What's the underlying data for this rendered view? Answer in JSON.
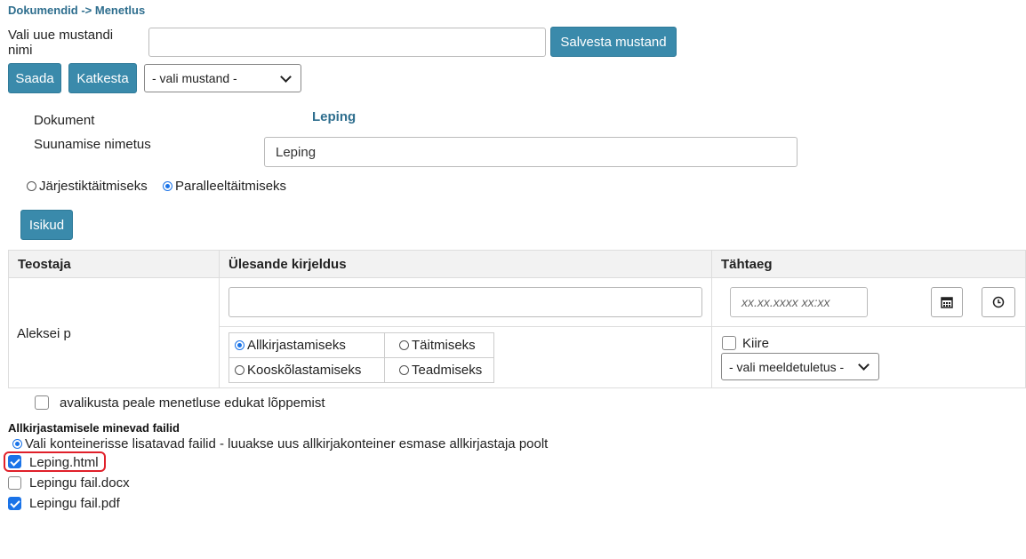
{
  "breadcrumb": "Dokumendid -> Menetlus",
  "template": {
    "name_label": "Vali uue mustandi nimi",
    "name_value": "",
    "save_button": "Salvesta mustand",
    "select_value": "- vali mustand -"
  },
  "actions": {
    "send": "Saada",
    "cancel": "Katkesta"
  },
  "document": {
    "label": "Dokument",
    "value": "Leping",
    "routing_label": "Suunamise nimetus",
    "routing_value": "Leping"
  },
  "mode": {
    "sequential": "Järjestiktäitmiseks",
    "parallel": "Paralleeltäitmiseks",
    "selected": "parallel"
  },
  "persons_button": "Isikud",
  "table": {
    "headers": [
      "Teostaja",
      "Ülesande kirjeldus",
      "Tähtaeg"
    ],
    "row": {
      "executor": "Aleksei p",
      "description": "",
      "deadline_placeholder": "xx.xx.xxxx xx:xx",
      "task_types": [
        "Allkirjastamiseks",
        "Täitmiseks",
        "Kooskõlastamiseks",
        "Teadmiseks"
      ],
      "selected_task": "Allkirjastamiseks",
      "urgent_label": "Kiire",
      "reminder_select": "- vali meeldetuletus -"
    }
  },
  "publish_label": "avalikusta peale menetluse edukat lõppemist",
  "files": {
    "heading": "Allkirjastamisele minevad failid",
    "container_option": "Vali konteinerisse lisatavad failid - luuakse uus allkirjakonteiner esmase allkirjastaja poolt",
    "items": [
      {
        "name": "Leping.html",
        "checked": true
      },
      {
        "name": "Lepingu fail.docx",
        "checked": false
      },
      {
        "name": "Lepingu fail.pdf",
        "checked": true
      }
    ]
  },
  "colors": {
    "accent": "#3a8aab",
    "link": "#2e6e8e",
    "highlight": "#e0202a",
    "check": "#1a73e8"
  }
}
